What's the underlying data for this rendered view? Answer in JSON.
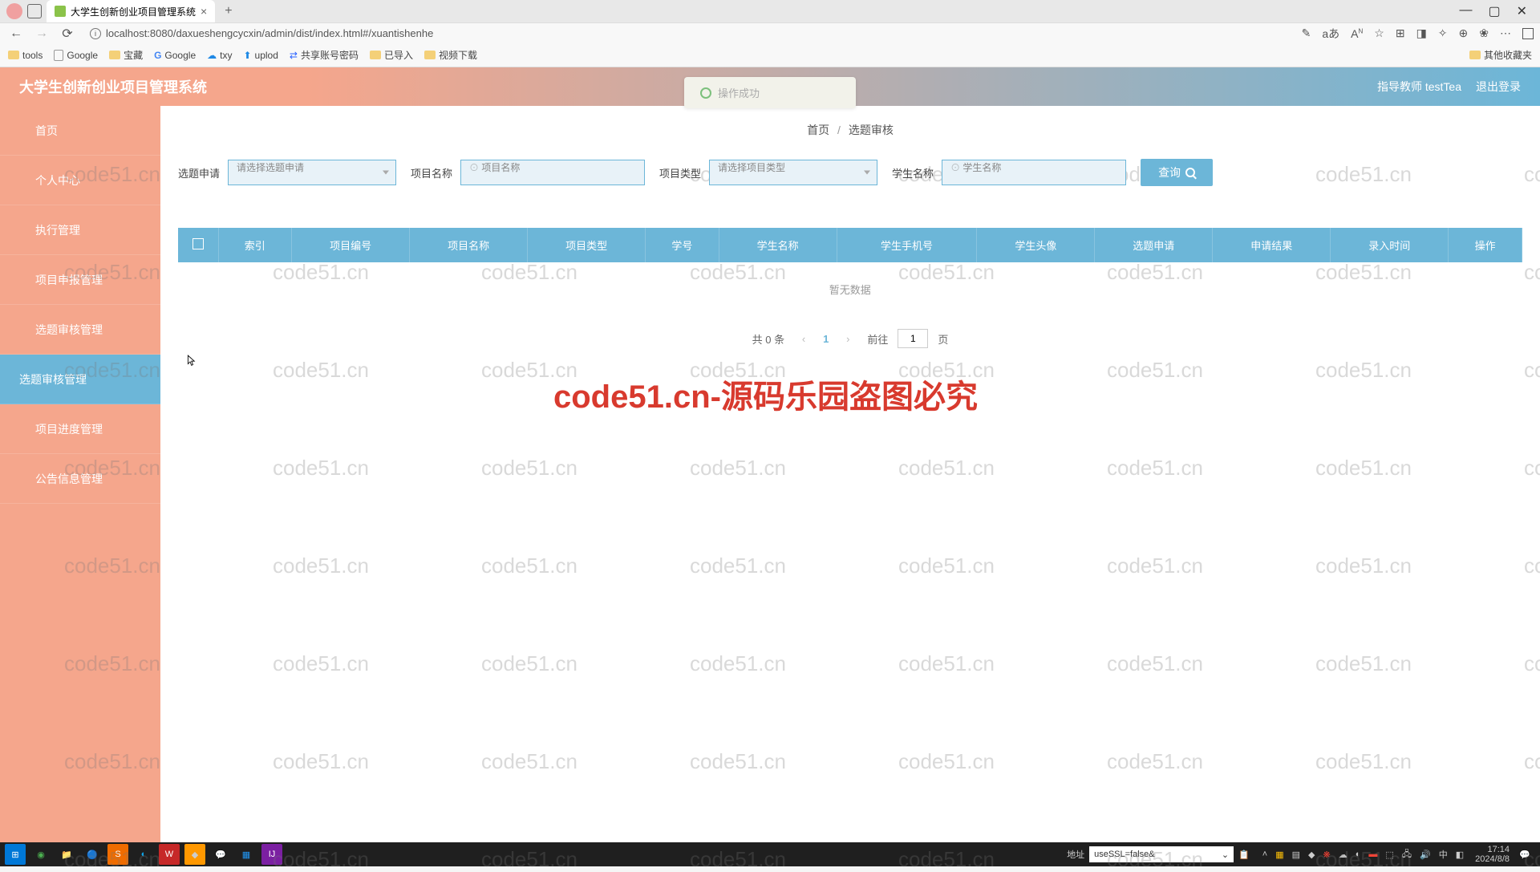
{
  "browser": {
    "tab_title": "大学生创新创业项目管理系统",
    "url": "localhost:8080/daxueshengcycxin/admin/dist/index.html#/xuantishenhe",
    "bookmarks": [
      "tools",
      "Google",
      "宝藏",
      "Google",
      "txy",
      "uplod",
      "共享账号密码",
      "已导入",
      "视频下载"
    ],
    "bookmark_right": "其他收藏夹"
  },
  "app": {
    "title": "大学生创新创业项目管理系统",
    "user_label": "指导教师 testTea",
    "logout": "退出登录"
  },
  "sidebar": {
    "items": [
      {
        "label": "首页"
      },
      {
        "label": "个人中心"
      },
      {
        "label": "执行管理"
      },
      {
        "label": "项目申报管理"
      },
      {
        "label": "选题审核管理"
      },
      {
        "label": "选题审核管理"
      },
      {
        "label": "项目进度管理"
      },
      {
        "label": "公告信息管理"
      }
    ]
  },
  "breadcrumb": {
    "home": "首页",
    "current": "选题审核"
  },
  "filters": {
    "f1_label": "选题申请",
    "f1_placeholder": "请选择选题申请",
    "f2_label": "项目名称",
    "f2_placeholder": "项目名称",
    "f3_label": "项目类型",
    "f3_placeholder": "请选择项目类型",
    "f4_label": "学生名称",
    "f4_placeholder": "学生名称",
    "search_btn": "查询"
  },
  "table": {
    "headers": [
      "索引",
      "项目编号",
      "项目名称",
      "项目类型",
      "学号",
      "学生名称",
      "学生手机号",
      "学生头像",
      "选题申请",
      "申请结果",
      "录入时间",
      "操作"
    ],
    "empty": "暂无数据"
  },
  "pagination": {
    "total": "共 0 条",
    "current": "1",
    "goto_prefix": "前往",
    "goto_value": "1",
    "goto_suffix": "页"
  },
  "toast": "操作成功",
  "watermark": "code51.cn",
  "big_watermark": "code51.cn-源码乐园盗图必究",
  "taskbar": {
    "addr_label": "地址",
    "addr_value": "useSSL=false&",
    "time": "17:14",
    "date": "2024/8/8"
  }
}
